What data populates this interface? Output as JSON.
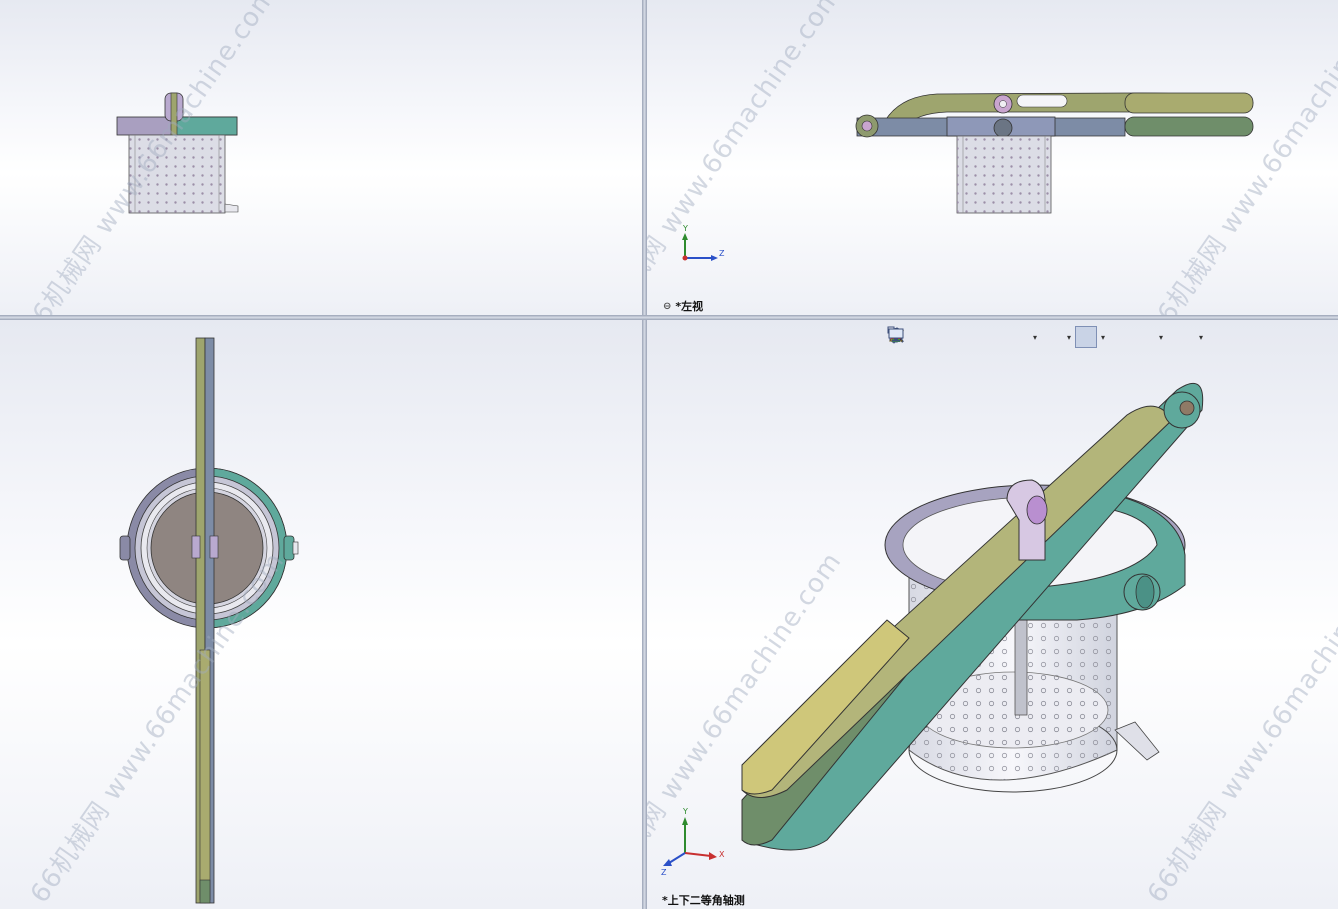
{
  "viewports": {
    "top_left": {
      "label": ""
    },
    "top_right": {
      "label": "*左视"
    },
    "bottom_left": {
      "label": ""
    },
    "bottom_right": {
      "label": "*上下二等角轴测"
    }
  },
  "watermark": {
    "text": "66机械网 www.66machine.com"
  },
  "axes": {
    "x": "X",
    "y": "Y",
    "z": "Z"
  },
  "toolbar": {
    "items": [
      {
        "name": "zoom-to-fit-icon"
      },
      {
        "name": "zoom-to-area-icon"
      },
      {
        "name": "previous-view-icon"
      },
      {
        "name": "section-view-icon"
      },
      {
        "name": "dynamic-annotation-icon"
      },
      {
        "name": "view-orientation-icon",
        "dropdown": true
      },
      {
        "name": "display-style-icon",
        "dropdown": true
      },
      {
        "name": "hide-show-items-icon",
        "dropdown": true,
        "active": true
      },
      {
        "name": "edit-appearance-icon"
      },
      {
        "name": "apply-scene-icon",
        "dropdown": true
      },
      {
        "name": "view-settings-icon",
        "dropdown": true
      }
    ]
  },
  "colors": {
    "handle_upper": "#9ea56e",
    "handle_lower": "#6f8e6a",
    "teal_ring": "#5fa99c",
    "lilac": "#b9a9cf",
    "basket": "#c8c9d6",
    "hole": "#9c8fa8"
  }
}
